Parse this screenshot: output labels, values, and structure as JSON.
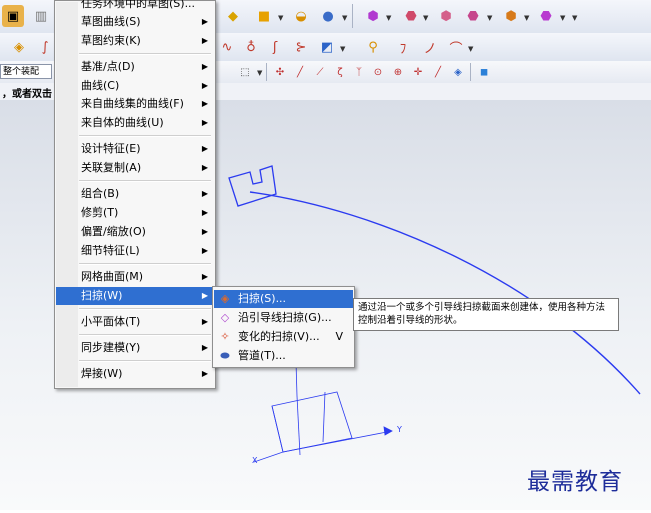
{
  "toolbar_row1": {
    "icons": [
      "solid-block-icon",
      "cylinder-icon",
      "shaded-view-icon",
      "cube-icon",
      "bowl-surface-icon",
      "sphere-icon",
      "assembly-icon-1",
      "assembly-icon-2",
      "assembly-icon-3",
      "assembly-icon-4",
      "assembly-icon-5",
      "assembly-icon-6"
    ]
  },
  "toolbar_row2": {
    "icons": [
      "sketch-icon",
      "curve-icon",
      "spline-icon",
      "offset-curve-icon",
      "trim-curve-icon",
      "extend-curve-icon",
      "edit-curve-icon",
      "sweep-tool-icon",
      "bridge-icon",
      "arc-icon",
      "fillet-curve-icon"
    ]
  },
  "selection_bar": {
    "filter_value": "整个装配",
    "icons": [
      "select-box-icon",
      "point-snap-icon",
      "line-snap-icon",
      "end-point-icon",
      "arc-center-icon",
      "midpoint-icon",
      "circle-icon",
      "intersection-icon",
      "tangent-icon",
      "point-on-curve-icon",
      "cube-snap-icon"
    ]
  },
  "cue_line": "，或者双击",
  "main_menu": {
    "items": [
      {
        "label": "任务环境中的草图(S)...",
        "submenu": false
      },
      {
        "label": "草图曲线(S)",
        "submenu": true
      },
      {
        "label": "草图约束(K)",
        "submenu": true
      },
      {
        "label": "基准/点(D)",
        "submenu": true
      },
      {
        "label": "曲线(C)",
        "submenu": true
      },
      {
        "label": "来自曲线集的曲线(F)",
        "submenu": true
      },
      {
        "label": "来自体的曲线(U)",
        "submenu": true
      },
      {
        "label": "设计特征(E)",
        "submenu": true
      },
      {
        "label": "关联复制(A)",
        "submenu": true
      },
      {
        "label": "组合(B)",
        "submenu": true
      },
      {
        "label": "修剪(T)",
        "submenu": true
      },
      {
        "label": "偏置/缩放(O)",
        "submenu": true
      },
      {
        "label": "细节特征(L)",
        "submenu": true
      },
      {
        "label": "网格曲面(M)",
        "submenu": true
      },
      {
        "label": "扫掠(W)",
        "submenu": true
      },
      {
        "label": "小平面体(T)",
        "submenu": true
      },
      {
        "label": "同步建模(Y)",
        "submenu": true
      },
      {
        "label": "焊接(W)",
        "submenu": true
      }
    ]
  },
  "sweep_submenu": {
    "items": [
      {
        "label": "扫掠(S)...",
        "icon": "sweep-icon",
        "shortcut": ""
      },
      {
        "label": "沿引导线扫掠(G)...",
        "icon": "sweep-along-guide-icon",
        "shortcut": ""
      },
      {
        "label": "变化的扫掠(V)...",
        "icon": "variational-sweep-icon",
        "shortcut": "V"
      },
      {
        "label": "管道(T)...",
        "icon": "tube-icon",
        "shortcut": ""
      }
    ]
  },
  "tooltip": "通过沿一个或多个引导线扫掠截面来创建体，使用各种方法控制沿着引导线的形状。",
  "axes": {
    "x_label": "X",
    "y_label": "Y"
  },
  "watermark": "最需教育",
  "colors": {
    "highlight": "#2f6fd1",
    "curve": "#2b3bf0",
    "watermark": "#1e2d9a"
  }
}
